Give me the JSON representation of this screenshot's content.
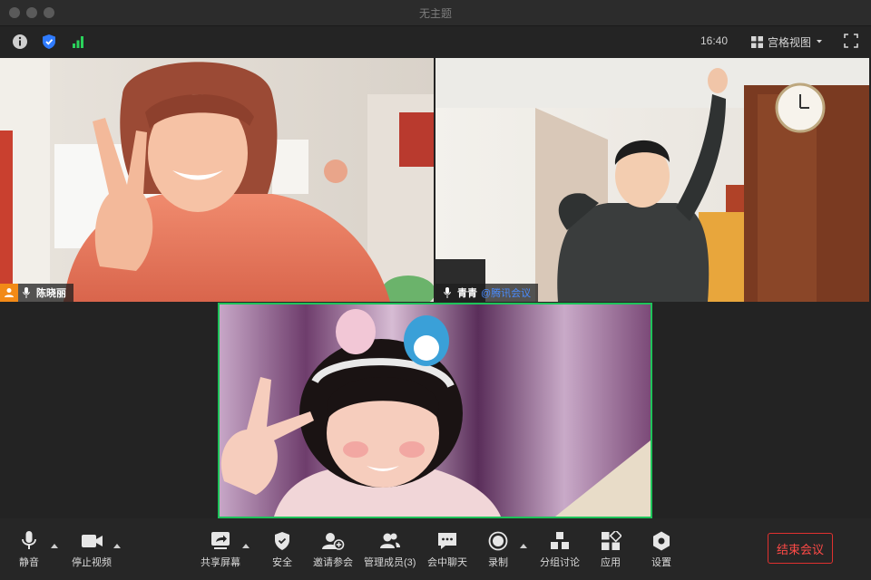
{
  "window": {
    "title": "无主题"
  },
  "infobar": {
    "time": "16:40",
    "view_mode": "宫格视图",
    "colors": {
      "shield": "#2f7bff",
      "signal": "#2bd25b"
    }
  },
  "participants": [
    {
      "name": "陈晓丽",
      "org": "",
      "is_host": true
    },
    {
      "name": "青青",
      "org": "@腾讯会议",
      "is_host": false
    },
    {
      "name": "",
      "org": "",
      "is_host": false,
      "active_speaker": true
    }
  ],
  "toolbar": {
    "mute": "静音",
    "stop_video": "停止视频",
    "share": "共享屏幕",
    "security": "安全",
    "invite": "邀请参会",
    "manage": "管理成员(3)",
    "chat": "会中聊天",
    "record": "录制",
    "breakout": "分组讨论",
    "apps": "应用",
    "settings": "设置",
    "end": "结束会议"
  }
}
